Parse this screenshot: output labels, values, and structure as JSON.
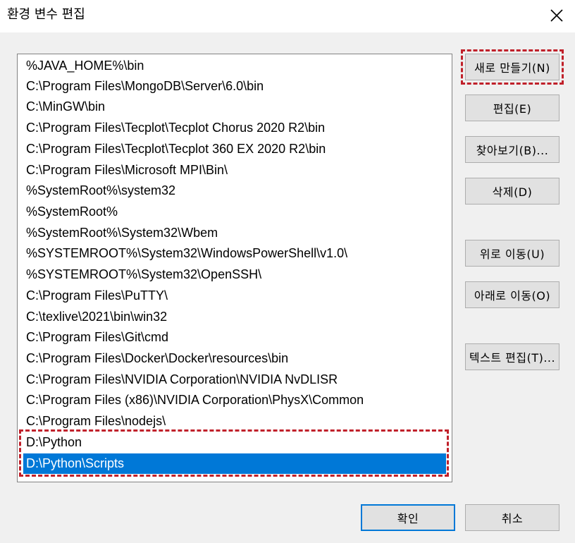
{
  "window": {
    "title": "환경 변수 편집"
  },
  "paths": [
    "%JAVA_HOME%\\bin",
    "C:\\Program Files\\MongoDB\\Server\\6.0\\bin",
    "C:\\MinGW\\bin",
    "C:\\Program Files\\Tecplot\\Tecplot Chorus 2020 R2\\bin",
    "C:\\Program Files\\Tecplot\\Tecplot 360 EX 2020 R2\\bin",
    "C:\\Program Files\\Microsoft MPI\\Bin\\",
    "%SystemRoot%\\system32",
    "%SystemRoot%",
    "%SystemRoot%\\System32\\Wbem",
    "%SYSTEMROOT%\\System32\\WindowsPowerShell\\v1.0\\",
    "%SYSTEMROOT%\\System32\\OpenSSH\\",
    "C:\\Program Files\\PuTTY\\",
    "C:\\texlive\\2021\\bin\\win32",
    "C:\\Program Files\\Git\\cmd",
    "C:\\Program Files\\Docker\\Docker\\resources\\bin",
    "C:\\Program Files\\NVIDIA Corporation\\NVIDIA NvDLISR",
    "C:\\Program Files (x86)\\NVIDIA Corporation\\PhysX\\Common",
    "C:\\Program Files\\nodejs\\",
    "D:\\Python",
    "D:\\Python\\Scripts"
  ],
  "selected_index": 19,
  "buttons": {
    "new": "새로 만들기(N)",
    "edit": "편집(E)",
    "browse": "찾아보기(B)...",
    "delete": "삭제(D)",
    "move_up": "위로 이동(U)",
    "move_down": "아래로 이동(O)",
    "edit_text": "텍스트 편집(T)...",
    "ok": "확인",
    "cancel": "취소"
  },
  "colors": {
    "selection": "#0078d7",
    "highlight_dashes": "#c0202a"
  }
}
